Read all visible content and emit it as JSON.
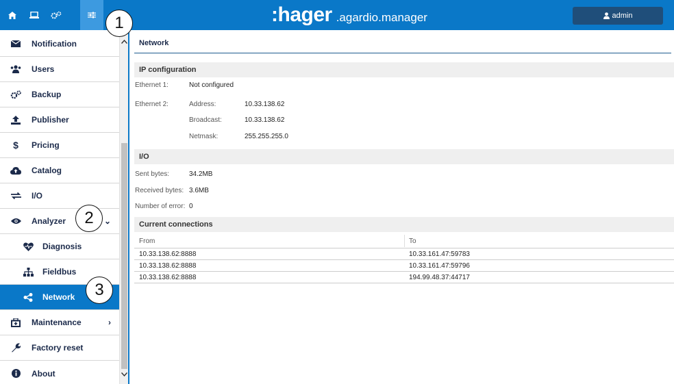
{
  "topbar": {
    "brand_logo": ":hager",
    "brand_sub": ".agardio.manager",
    "user": "admin",
    "buttons": [
      "home-icon",
      "laptop-icon",
      "gears-icon",
      "sliders-icon"
    ]
  },
  "sidebar": {
    "items": [
      {
        "label": "Notification",
        "icon": "envelope-icon"
      },
      {
        "label": "Users",
        "icon": "users-icon"
      },
      {
        "label": "Backup",
        "icon": "cogs-icon"
      },
      {
        "label": "Publisher",
        "icon": "upload-icon"
      },
      {
        "label": "Pricing",
        "icon": "dollar-icon"
      },
      {
        "label": "Catalog",
        "icon": "cloud-icon"
      },
      {
        "label": "I/O",
        "icon": "exchange-icon"
      },
      {
        "label": "Analyzer",
        "icon": "eye-icon"
      },
      {
        "label": "Diagnosis",
        "icon": "heartbeat-icon"
      },
      {
        "label": "Fieldbus",
        "icon": "sitemap-icon"
      },
      {
        "label": "Network",
        "icon": "share-icon"
      },
      {
        "label": "Maintenance",
        "icon": "toolbox-icon"
      },
      {
        "label": "Factory reset",
        "icon": "wrench-icon"
      },
      {
        "label": "About",
        "icon": "info-icon"
      }
    ]
  },
  "callouts": [
    "1",
    "2",
    "3"
  ],
  "main": {
    "title": "Network",
    "ip_section": "IP configuration",
    "eth1_label": "Ethernet 1:",
    "eth1_value": "Not configured",
    "eth2_label": "Ethernet 2:",
    "address_label": "Address:",
    "address_value": "10.33.138.62",
    "broadcast_label": "Broadcast:",
    "broadcast_value": "10.33.138.62",
    "netmask_label": "Netmask:",
    "netmask_value": "255.255.255.0",
    "io_section": "I/O",
    "sent_label": "Sent bytes:",
    "sent_value": "34.2MB",
    "recv_label": "Received bytes:",
    "recv_value": "3.6MB",
    "err_label": "Number of error:",
    "err_value": "0",
    "conn_section": "Current connections",
    "conn_headers": [
      "From",
      "To"
    ],
    "connections": [
      {
        "from": "10.33.138.62:8888",
        "to": "10.33.161.47:59783"
      },
      {
        "from": "10.33.138.62:8888",
        "to": "10.33.161.47:59796"
      },
      {
        "from": "10.33.138.62:8888",
        "to": "194.99.48.37:44717"
      }
    ]
  },
  "colors": {
    "primary": "#0a78c8",
    "admin_bg": "#1f4e7a",
    "section_bg": "#efefef"
  }
}
